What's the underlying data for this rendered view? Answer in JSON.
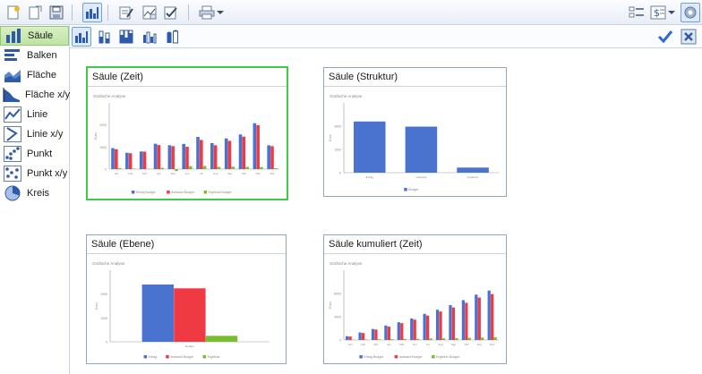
{
  "colors": {
    "series_blue": "#4a72cf",
    "series_red": "#ef3a43",
    "series_green": "#79bd30",
    "selected_border": "#3ccc4a",
    "accent": "#6fa0e0"
  },
  "toolbar": {
    "icons": [
      "new-document-icon",
      "open-document-icon",
      "save-icon",
      "column-chart-icon",
      "edit-icon",
      "chart-edit-icon",
      "check-edit-icon",
      "print-icon",
      "print-dropdown-chevron-icon",
      "layout-icon",
      "currency-icon",
      "currency-dropdown-chevron-icon",
      "settings-icon"
    ]
  },
  "subtoolbar": {
    "icons": [
      "column-clustered-icon",
      "column-stacked-icon",
      "column-stacked-percent-icon",
      "column-3d-icon",
      "column-cylinder-icon",
      "confirm-check-icon",
      "close-x-icon"
    ]
  },
  "sidebar": {
    "items": [
      {
        "label": "Säule",
        "icon": "column-chart-icon",
        "selected": true
      },
      {
        "label": "Balken",
        "icon": "bar-chart-icon",
        "selected": false
      },
      {
        "label": "Fläche",
        "icon": "area-chart-icon",
        "selected": false
      },
      {
        "label": "Fläche x/y",
        "icon": "area-xy-chart-icon",
        "selected": false
      },
      {
        "label": "Linie",
        "icon": "line-chart-icon",
        "selected": false
      },
      {
        "label": "Linie x/y",
        "icon": "line-xy-chart-icon",
        "selected": false
      },
      {
        "label": "Punkt",
        "icon": "scatter-chart-icon",
        "selected": false
      },
      {
        "label": "Punkt x/y",
        "icon": "scatter-xy-chart-icon",
        "selected": false
      },
      {
        "label": "Kreis",
        "icon": "pie-chart-icon",
        "selected": false
      }
    ]
  },
  "cards": [
    {
      "title": "Säule (Zeit)",
      "selected": true
    },
    {
      "title": "Säule (Struktur)",
      "selected": false
    },
    {
      "title": "Säule (Ebene)",
      "selected": false
    },
    {
      "title": "Säule kumuliert (Zeit)",
      "selected": false
    }
  ],
  "chart_data": [
    {
      "type": "bar",
      "title": "Grafische Analyse",
      "categories": [
        "Jan",
        "Feb",
        "Mrz",
        "Apr",
        "Mai",
        "Jun",
        "Jul",
        "Aug",
        "Sep",
        "Okt",
        "Nov",
        "Dez"
      ],
      "ylim": [
        0,
        3000
      ],
      "yticks": [
        "0",
        "1000",
        "2000"
      ],
      "ylabel": "Euro",
      "series": [
        {
          "name": "Ertrag Budget",
          "color": "#4a72cf",
          "values": [
            950,
            740,
            800,
            1150,
            1080,
            1140,
            1460,
            1180,
            1390,
            1570,
            2080,
            1080
          ]
        },
        {
          "name": "Aufwand Budget",
          "color": "#ef3a43",
          "values": [
            900,
            720,
            790,
            1090,
            1040,
            1010,
            1320,
            1080,
            1280,
            1470,
            1990,
            1040
          ]
        },
        {
          "name": "Ergebnis Budget",
          "color": "#79bd30",
          "values": [
            50,
            20,
            10,
            60,
            -80,
            130,
            140,
            100,
            110,
            100,
            90,
            40
          ]
        }
      ],
      "legend_position": "bottom"
    },
    {
      "type": "bar",
      "title": "Grafische Analyse",
      "categories": [
        "Ertrag",
        "Aufwand",
        "Ergebnis"
      ],
      "ylim": [
        0,
        3000
      ],
      "yticks": [
        "0",
        "1000",
        "2000"
      ],
      "ylabel": "Euro",
      "series": [
        {
          "name": "Budget",
          "color": "#4a72cf",
          "values": [
            2200,
            1980,
            220
          ]
        }
      ],
      "legend_position": "bottom"
    },
    {
      "type": "bar",
      "title": "Grafische Analyse",
      "categories": [
        "Budget"
      ],
      "ylim": [
        0,
        3000
      ],
      "yticks": [
        "0",
        "1000",
        "2000"
      ],
      "ylabel": "Euro",
      "series": [
        {
          "name": "Ertrag",
          "color": "#4a72cf",
          "values": [
            2400
          ]
        },
        {
          "name": "Aufwand Budget",
          "color": "#ef3a43",
          "values": [
            2240
          ]
        },
        {
          "name": "Ergebnis",
          "color": "#79bd30",
          "values": [
            250
          ]
        }
      ],
      "legend_position": "bottom"
    },
    {
      "type": "bar",
      "title": "Grafische Analyse",
      "categories": [
        "Jan",
        "Feb",
        "Mrz",
        "Apr",
        "Mai",
        "Jun",
        "Jul",
        "Aug",
        "Sep",
        "Okt",
        "Nov",
        "Dez"
      ],
      "ylim": [
        0,
        12000
      ],
      "yticks": [
        "0",
        "4000",
        "8000"
      ],
      "ylabel": "Euro",
      "series": [
        {
          "name": "Ertrag Budget",
          "color": "#4a72cf",
          "values": [
            650,
            1300,
            1900,
            2500,
            3050,
            3700,
            4500,
            5200,
            6000,
            6850,
            7800,
            8500
          ]
        },
        {
          "name": "Aufwand Budget",
          "color": "#ef3a43",
          "values": [
            600,
            1200,
            1800,
            2300,
            2900,
            3500,
            4200,
            4900,
            5600,
            6400,
            7300,
            7900
          ]
        },
        {
          "name": "Ergebnis Budget",
          "color": "#79bd30",
          "values": [
            50,
            90,
            120,
            160,
            180,
            210,
            260,
            290,
            330,
            380,
            420,
            460
          ]
        }
      ],
      "legend_position": "bottom"
    }
  ]
}
